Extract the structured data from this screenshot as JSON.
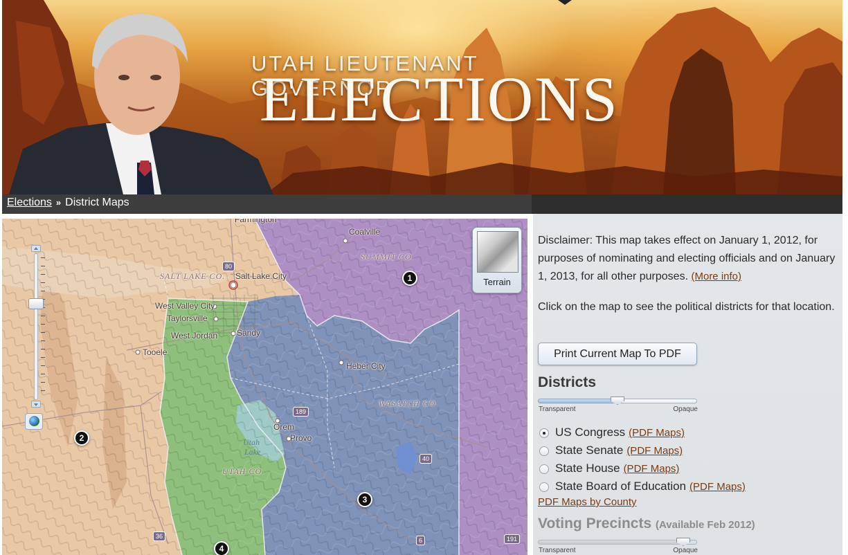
{
  "banner": {
    "title_line1": "UTAH LIEUTENANT GOVERNOR",
    "title_line2": "ELECTIONS"
  },
  "breadcrumb": {
    "root": "Elections",
    "separator": "»",
    "current": "District Maps"
  },
  "map": {
    "terrain_button_label": "Terrain",
    "zoom_level_fraction": 0.67,
    "cities": [
      "Farmington",
      "Coalville",
      "Salt Lake City",
      "West Valley City",
      "Taylorsville",
      "West Jordan",
      "Sandy",
      "Tooele",
      "Heber City",
      "Orem",
      "Provo"
    ],
    "counties": [
      "SUMMIT CO.",
      "SALT LAKE CO.",
      "WASATCH CO.",
      "UTAH CO."
    ],
    "lakes": [
      "Utah",
      "Lake"
    ],
    "highway_shields": [
      "80",
      "189",
      "40",
      "36",
      "6",
      "191"
    ],
    "district_markers": [
      "1",
      "2",
      "3",
      "4"
    ],
    "district_colors": {
      "1": "#b392c6",
      "2": "#e9c8a6",
      "3": "#7e93b8",
      "4": "#8cbd7a"
    }
  },
  "panel": {
    "disclaimer": "Disclaimer: This map takes effect on January 1, 2012, for purposes of nominating and electing officials and on January 1, 2013, for all other purposes.",
    "more_info_link": "(More info)",
    "instruction": "Click on the map to see the political districts for that location.",
    "print_button": "Print Current Map To PDF",
    "districts_heading": "Districts",
    "districts_opacity": 0.5,
    "slider_left_label": "Transparent",
    "slider_right_label": "Opaque",
    "district_options": [
      {
        "label": "US Congress",
        "link": "(PDF Maps)",
        "selected": true
      },
      {
        "label": "State Senate",
        "link": "(PDF Maps)",
        "selected": false
      },
      {
        "label": "State House",
        "link": "(PDF Maps)",
        "selected": false
      },
      {
        "label": "State Board of Education",
        "link": "(PDF Maps)",
        "selected": false
      }
    ],
    "county_link": "PDF Maps by County",
    "precincts_heading": "Voting Precincts",
    "precincts_note": "(Available Feb 2012)",
    "precincts_opacity": 0.95
  },
  "colors": {
    "link": "#7a3b12",
    "breadcrumb_bar": "#3d3d3d",
    "panel_bg": "#e2e5e8"
  }
}
